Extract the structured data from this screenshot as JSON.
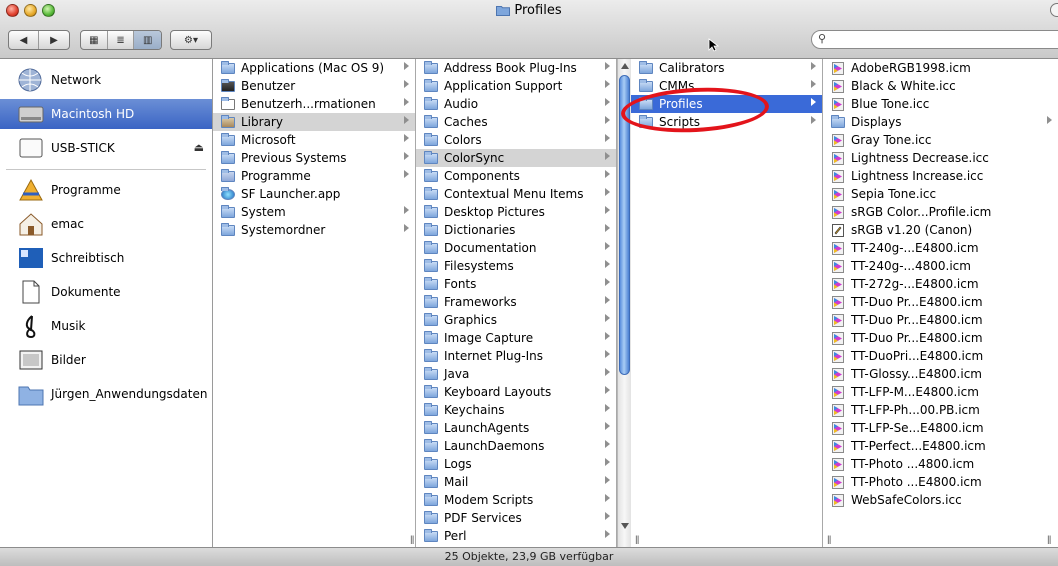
{
  "window": {
    "title": "Profiles"
  },
  "toolbar": {
    "nav_back": "◀",
    "nav_forward": "▶",
    "view_icon": "▦",
    "view_list": "≣",
    "view_column": "▥",
    "action": "⚙▾",
    "search_placeholder": "",
    "search_icon": "magnifier-icon"
  },
  "sidebar": {
    "devices": [
      {
        "label": "Network",
        "icon": "network-globe-icon"
      },
      {
        "label": "Macintosh HD",
        "icon": "hard-drive-icon",
        "selected": true
      },
      {
        "label": "USB-STICK",
        "icon": "usb-drive-icon",
        "eject": "⏏"
      }
    ],
    "places": [
      {
        "label": "Programme",
        "icon": "applications-icon"
      },
      {
        "label": "emac",
        "icon": "home-icon"
      },
      {
        "label": "Schreibtisch",
        "icon": "desktop-icon"
      },
      {
        "label": "Dokumente",
        "icon": "documents-icon"
      },
      {
        "label": "Musik",
        "icon": "music-icon"
      },
      {
        "label": "Bilder",
        "icon": "pictures-icon"
      },
      {
        "label": "Jürgen_Anwendungsdaten",
        "icon": "folder-icon"
      }
    ]
  },
  "columns": {
    "col1": [
      {
        "label": "Applications (Mac OS 9)",
        "icon": "folder",
        "arrow": true
      },
      {
        "label": "Benutzer",
        "icon": "users-folder",
        "arrow": true
      },
      {
        "label": "Benutzerh...rmationen",
        "icon": "file",
        "arrow": true
      },
      {
        "label": "Library",
        "icon": "library-folder",
        "arrow": true,
        "selected": "gray"
      },
      {
        "label": "Microsoft",
        "icon": "folder",
        "arrow": true
      },
      {
        "label": "Previous Systems",
        "icon": "folder",
        "arrow": true
      },
      {
        "label": "Programme",
        "icon": "applications-folder",
        "arrow": true
      },
      {
        "label": "SF Launcher.app",
        "icon": "app",
        "arrow": false
      },
      {
        "label": "System",
        "icon": "folder",
        "arrow": true
      },
      {
        "label": "Systemordner",
        "icon": "folder",
        "arrow": true
      }
    ],
    "col2": [
      {
        "label": "Address Book Plug-Ins",
        "arrow": true
      },
      {
        "label": "Application Support",
        "arrow": true
      },
      {
        "label": "Audio",
        "arrow": true
      },
      {
        "label": "Caches",
        "arrow": true
      },
      {
        "label": "Colors",
        "arrow": true
      },
      {
        "label": "ColorSync",
        "arrow": true,
        "selected": "gray"
      },
      {
        "label": "Components",
        "arrow": true
      },
      {
        "label": "Contextual Menu Items",
        "arrow": true
      },
      {
        "label": "Desktop Pictures",
        "arrow": true
      },
      {
        "label": "Dictionaries",
        "arrow": true
      },
      {
        "label": "Documentation",
        "arrow": true
      },
      {
        "label": "Filesystems",
        "arrow": true
      },
      {
        "label": "Fonts",
        "arrow": true
      },
      {
        "label": "Frameworks",
        "arrow": true
      },
      {
        "label": "Graphics",
        "arrow": true
      },
      {
        "label": "Image Capture",
        "arrow": true
      },
      {
        "label": "Internet Plug-Ins",
        "arrow": true
      },
      {
        "label": "Java",
        "arrow": true
      },
      {
        "label": "Keyboard Layouts",
        "arrow": true
      },
      {
        "label": "Keychains",
        "arrow": true
      },
      {
        "label": "LaunchAgents",
        "arrow": true
      },
      {
        "label": "LaunchDaemons",
        "arrow": true
      },
      {
        "label": "Logs",
        "arrow": true
      },
      {
        "label": "Mail",
        "arrow": true
      },
      {
        "label": "Modem Scripts",
        "arrow": true
      },
      {
        "label": "PDF Services",
        "arrow": true
      },
      {
        "label": "Perl",
        "arrow": true
      }
    ],
    "col3": [
      {
        "label": "Calibrators",
        "arrow": true
      },
      {
        "label": "CMMs",
        "arrow": true
      },
      {
        "label": "Profiles",
        "arrow": true,
        "selected": "blue"
      },
      {
        "label": "Scripts",
        "arrow": true
      }
    ],
    "col4": [
      {
        "label": "AdobeRGB1998.icm",
        "icon": "profile"
      },
      {
        "label": "Black & White.icc",
        "icon": "profile"
      },
      {
        "label": "Blue Tone.icc",
        "icon": "profile"
      },
      {
        "label": "Displays",
        "icon": "folder",
        "arrow": true
      },
      {
        "label": "Gray Tone.icc",
        "icon": "profile"
      },
      {
        "label": "Lightness Decrease.icc",
        "icon": "profile"
      },
      {
        "label": "Lightness Increase.icc",
        "icon": "profile"
      },
      {
        "label": "Sepia Tone.icc",
        "icon": "profile"
      },
      {
        "label": "sRGB Color...Profile.icm",
        "icon": "profile"
      },
      {
        "label": "sRGB v1.20 (Canon)",
        "icon": "doc"
      },
      {
        "label": "TT-240g-...E4800.icm",
        "icon": "profile"
      },
      {
        "label": "TT-240g-...4800.icm",
        "icon": "profile"
      },
      {
        "label": "TT-272g-...E4800.icm",
        "icon": "profile"
      },
      {
        "label": "TT-Duo Pr...E4800.icm",
        "icon": "profile"
      },
      {
        "label": "TT-Duo Pr...E4800.icm",
        "icon": "profile"
      },
      {
        "label": "TT-Duo Pr...E4800.icm",
        "icon": "profile"
      },
      {
        "label": "TT-DuoPri...E4800.icm",
        "icon": "profile"
      },
      {
        "label": "TT-Glossy...E4800.icm",
        "icon": "profile"
      },
      {
        "label": "TT-LFP-M...E4800.icm",
        "icon": "profile"
      },
      {
        "label": "TT-LFP-Ph...00.PB.icm",
        "icon": "profile"
      },
      {
        "label": "TT-LFP-Se...E4800.icm",
        "icon": "profile"
      },
      {
        "label": "TT-Perfect...E4800.icm",
        "icon": "profile"
      },
      {
        "label": "TT-Photo ...4800.icm",
        "icon": "profile"
      },
      {
        "label": "TT-Photo ...E4800.icm",
        "icon": "profile"
      },
      {
        "label": "WebSafeColors.icc",
        "icon": "profile"
      }
    ]
  },
  "statusbar": {
    "text": "25 Objekte, 23,9 GB verfügbar"
  },
  "colors": {
    "selection_blue": "#3a6ad8",
    "selection_gray": "#d4d4d4",
    "annotation_red": "#e3141b"
  }
}
